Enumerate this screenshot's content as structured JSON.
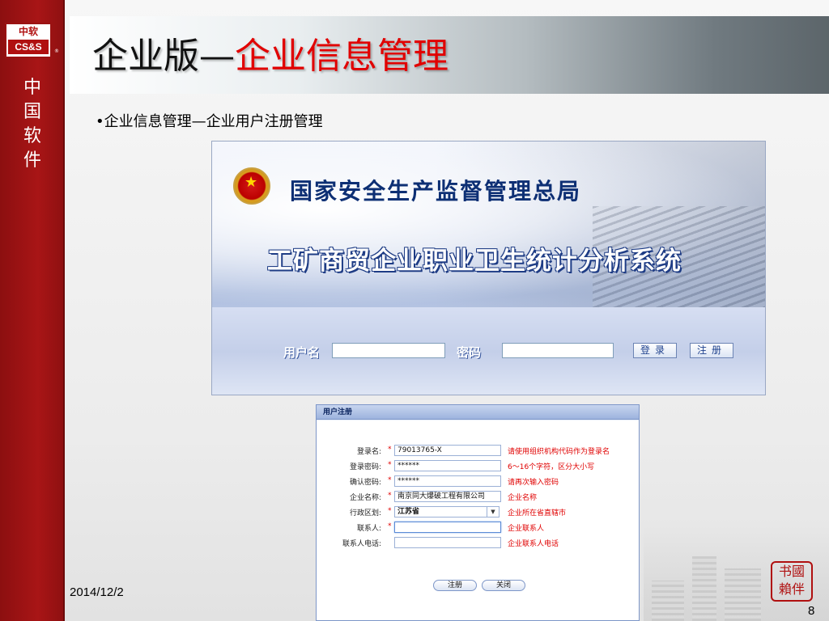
{
  "sidebar": {
    "logo_top": "中软",
    "logo_bottom": "CS&S",
    "logo_reg": "®",
    "vertical_text": [
      "中",
      "国",
      "软",
      "件"
    ]
  },
  "slide": {
    "title_black": "企业版—",
    "title_red": "企业信息管理",
    "bullet": "•企业信息管理—企业用户注册管理",
    "date": "2014/12/2",
    "page_number": "8",
    "seal_text": [
      "书國",
      "賴伴"
    ]
  },
  "login": {
    "org_name": "国家安全生产监督管理总局",
    "system_name": "工矿商贸企业职业卫生统计分析系统",
    "username_label": "用户名",
    "password_label": "密码",
    "username_value": "",
    "password_value": "",
    "login_button": "登录",
    "register_button": "注册"
  },
  "register": {
    "header": "用户注册",
    "fields": [
      {
        "label": "登录名:",
        "required": "*",
        "value": "79013765-X",
        "hint": "请使用组织机构代码作为登录名"
      },
      {
        "label": "登录密码:",
        "required": "*",
        "value": "******",
        "hint": "6～16个字符，区分大小写"
      },
      {
        "label": "确认密码:",
        "required": "*",
        "value": "******",
        "hint": "请再次输入密码"
      },
      {
        "label": "企业名称:",
        "required": "*",
        "value": "南京同大爆破工程有限公司",
        "hint": "企业名称"
      },
      {
        "label": "行政区划:",
        "required": "*",
        "value": "江苏省",
        "hint": "企业所在省直辖市"
      },
      {
        "label": "联系人:",
        "required": "*",
        "value": "",
        "hint": "企业联系人"
      },
      {
        "label": "联系人电话:",
        "required": "",
        "value": "",
        "hint": "企业联系人电话"
      }
    ],
    "register_button": "注册",
    "close_button": "关闭"
  },
  "colors": {
    "sidebar_red": "#a81516",
    "title_red": "#e10000",
    "hint_red": "#e00000",
    "login_blue": "#0d2f74"
  }
}
